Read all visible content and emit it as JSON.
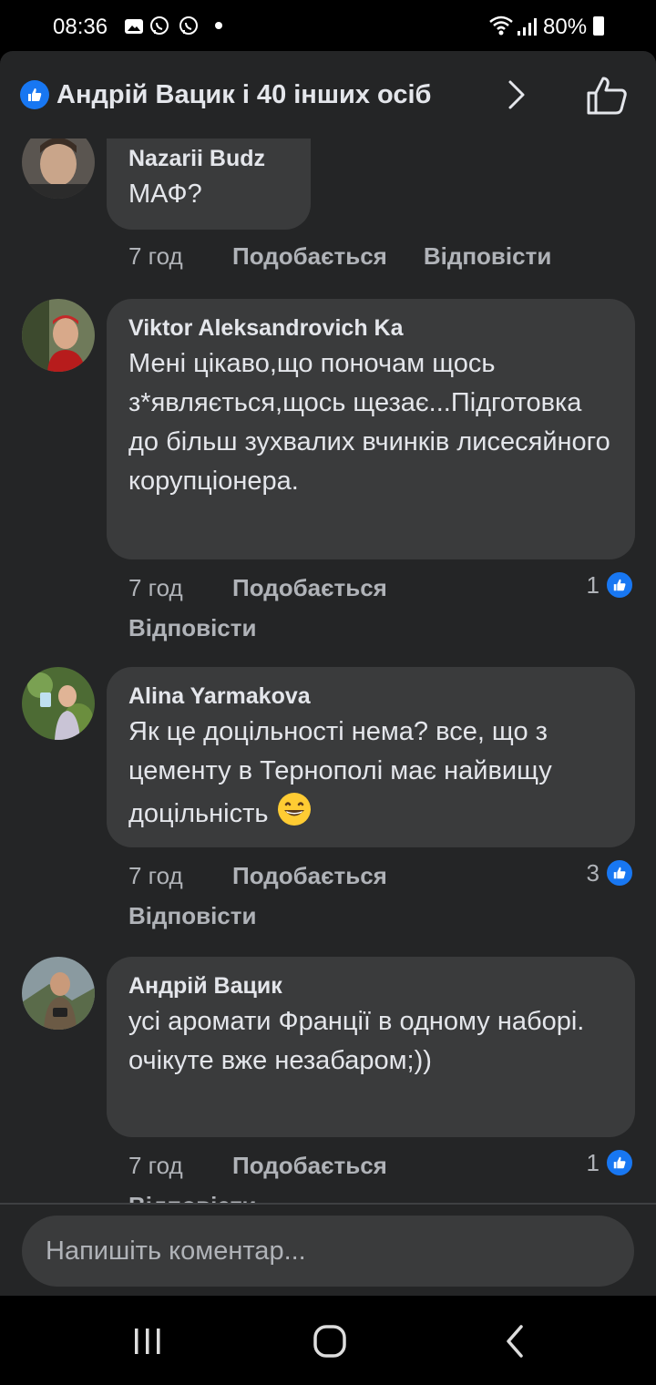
{
  "status_bar": {
    "time": "08:36",
    "battery": "80%",
    "icons": [
      "gallery-icon",
      "viber-icon",
      "viber-icon",
      "dot"
    ]
  },
  "header": {
    "title": "Андрій Вацик і 40 інших осіб",
    "like_color": "#1877f2"
  },
  "comments": [
    {
      "author": "Nazarii Budz",
      "text": "МАФ?",
      "time": "7 год",
      "like_label": "Подобається",
      "reply_label": "Відповісти",
      "reactions": ""
    },
    {
      "author": "Viktor Aleksandrovich Ka",
      "text": "Мені цікаво,що поночам щось з*являється,щось щезає...Підготовка до більш зухвалих вчинків лисесяйного корупціонера.",
      "time": "7 год",
      "like_label": "Подобається",
      "reply_label": "Відповісти",
      "reactions": "1"
    },
    {
      "author": "Alina Yarmakova",
      "text": "Як це доцільності нема? все, що з цементу в Тернополі має найвищу доцільність",
      "time": "7 год",
      "like_label": "Подобається",
      "reply_label": "Відповісти",
      "reactions": "3"
    },
    {
      "author": "Андрій Вацик",
      "text": "усі аромати Франції в одному наборі. очікуте вже незабаром;))",
      "time": "7 год",
      "like_label": "Подобається",
      "reply_label": "Відповісти",
      "reactions": "1"
    }
  ],
  "composer": {
    "placeholder": "Напишіть коментар..."
  }
}
